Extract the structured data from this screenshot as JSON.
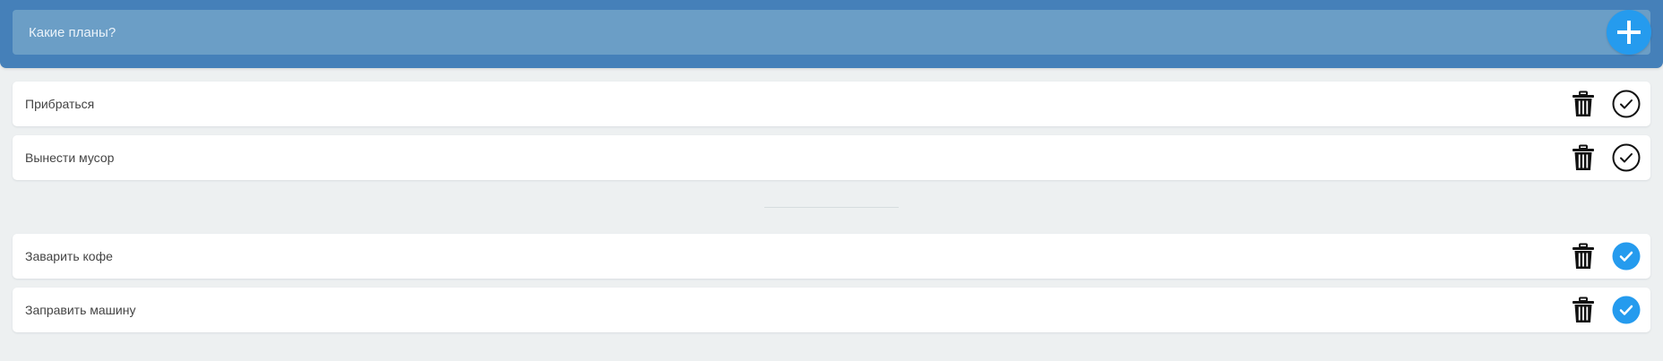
{
  "header": {
    "input_placeholder": "Какие планы?",
    "add_button_icon": "plus-icon"
  },
  "todo": {
    "items": [
      {
        "text": "Прибраться"
      },
      {
        "text": "Вынести мусор"
      }
    ]
  },
  "completed": {
    "items": [
      {
        "text": "Заварить кофе"
      },
      {
        "text": "Заправить машину"
      }
    ]
  },
  "icons": {
    "delete": "trash-icon",
    "complete": "check-circle-icon"
  },
  "colors": {
    "header_bg": "#4580b9",
    "input_bg": "#6b9ec6",
    "accent": "#259bee",
    "page_bg": "#edf0f1"
  }
}
